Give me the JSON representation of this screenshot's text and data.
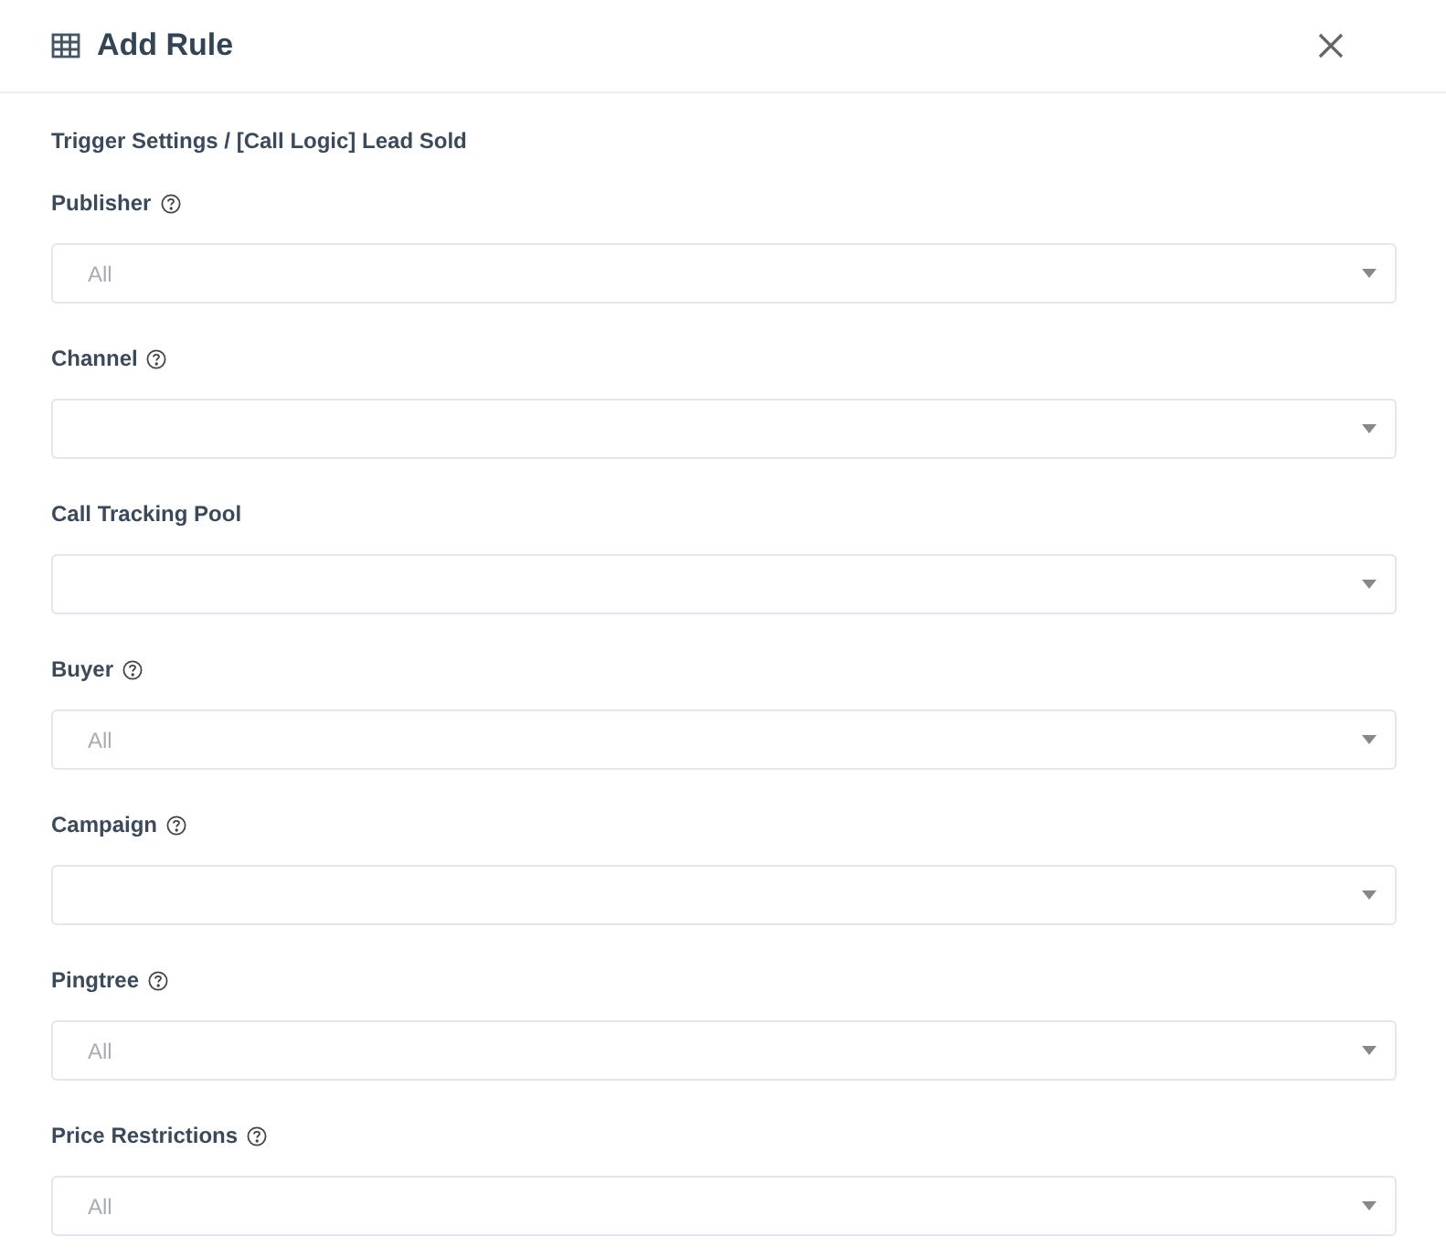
{
  "dialog": {
    "title": "Add Rule"
  },
  "breadcrumb": "Trigger Settings / [Call Logic] Lead Sold",
  "fields": [
    {
      "label": "Publisher",
      "help": true,
      "placeholder": "All"
    },
    {
      "label": "Channel",
      "help": true
    },
    {
      "label": "Call Tracking Pool",
      "help": false
    },
    {
      "label": "Buyer",
      "help": true,
      "placeholder": "All"
    },
    {
      "label": "Campaign",
      "help": true
    },
    {
      "label": "Pingtree",
      "help": true,
      "placeholder": "All"
    },
    {
      "label": "Price Restrictions",
      "help": true,
      "placeholder": "All"
    }
  ]
}
